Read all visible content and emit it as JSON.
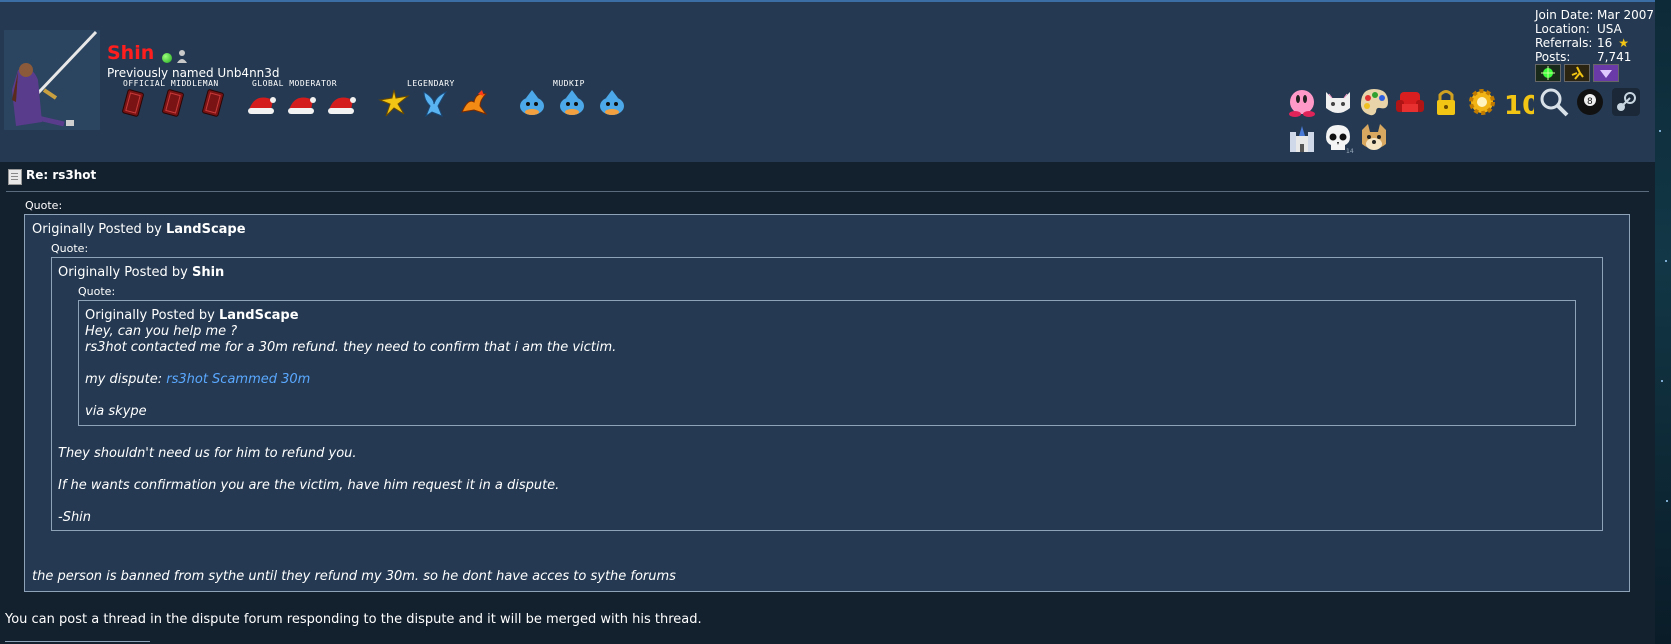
{
  "user": {
    "name": "Shin",
    "previously_named": "Previously named Unb4nn3d",
    "groups": [
      {
        "label": "OFFICIAL MIDDLEMAN",
        "icon": "middleman-card-icon"
      },
      {
        "label": "GLOBAL MODERATOR",
        "icon": "santa-hat-icon"
      },
      {
        "label": "LEGENDARY",
        "icon": "legendary-bird-icon"
      },
      {
        "label": "MUDKIP",
        "icon": "mudkip-icon"
      }
    ]
  },
  "info": {
    "join_label": "Join Date:",
    "join_value": "Mar 2007",
    "location_label": "Location:",
    "location_value": "USA",
    "referrals_label": "Referrals:",
    "referrals_value": "16",
    "posts_label": "Posts:",
    "posts_value": "7,741"
  },
  "awards": [
    "kirby-icon",
    "cat-icon",
    "palette-icon",
    "armchair-icon",
    "padlock-icon",
    "gear-icon",
    "ten-years-icon",
    "magnifier-icon",
    "eight-ball-icon",
    "steam-icon",
    "castle-icon",
    "skull-icon",
    "doge-icon"
  ],
  "post": {
    "title": "Re: rs3hot",
    "quote_label": "Quote:",
    "q1_prefix": "Originally Posted by ",
    "q1_author": "LandScape",
    "q2_prefix": "Originally Posted by ",
    "q2_author": "Shin",
    "q3_prefix": "Originally Posted by ",
    "q3_author": "LandScape",
    "q3_line1": "Hey, can you help me ?",
    "q3_line2": "rs3hot contacted me for a 30m refund. they need to confirm that i am the victim.",
    "q3_dispute_prefix": "my dispute: ",
    "q3_dispute_link": "rs3hot Scammed 30m",
    "q3_line4": "via skype",
    "q2_line1": "They shouldn't need us for him to refund you.",
    "q2_line2": "If he wants confirmation you are the victim, have him request it in a dispute.",
    "q2_line3": "-Shin",
    "q1_line1": "the person is banned from sythe until they refund my 30m. so he dont have acces to sythe forums",
    "body": "You can post a thread in the dispute forum responding to the dispute and it will be merged with his thread."
  }
}
